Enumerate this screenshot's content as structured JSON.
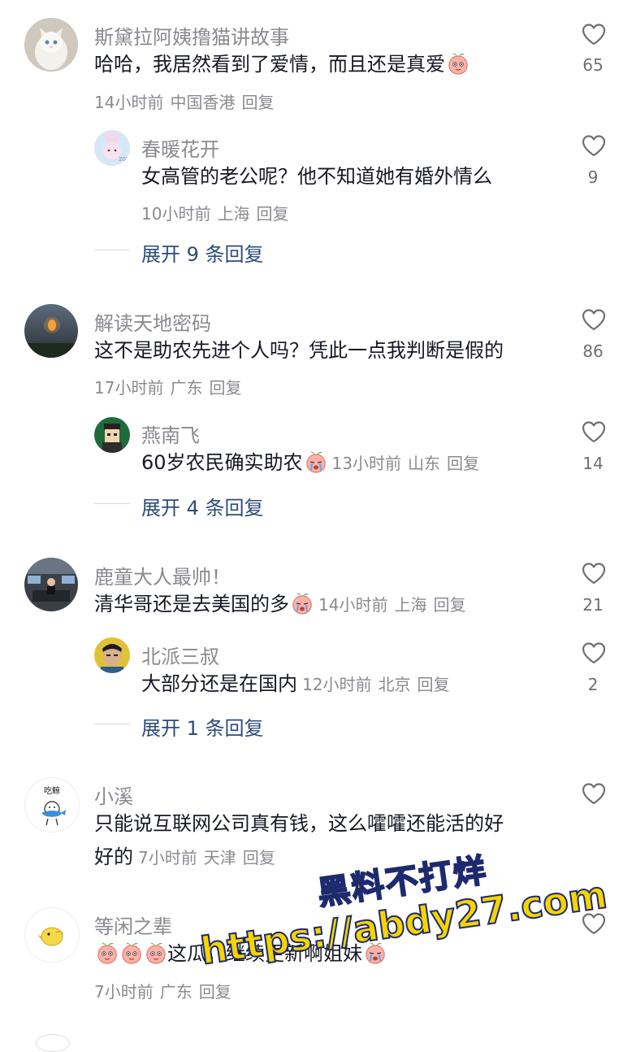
{
  "comments": [
    {
      "username": "斯黛拉阿姨撸猫讲故事",
      "text": "哈哈，我居然看到了爱情，而且还是真爱",
      "time": "14小时前",
      "location": "中国香港",
      "reply": "回复",
      "likes": "65",
      "emoji": "peach-face-icon",
      "replies": [
        {
          "username": "春暖花开",
          "text": "女高管的老公呢？他不知道她有婚外情么",
          "time": "10小时前",
          "location": "上海",
          "reply": "回复",
          "likes": "9"
        }
      ],
      "expand": "展开 9 条回复"
    },
    {
      "username": "解读天地密码",
      "text": "这不是助农先进个人吗？凭此一点我判断是假的",
      "time": "17小时前",
      "location": "广东",
      "reply": "回复",
      "likes": "86",
      "replies": [
        {
          "username": "燕南飞",
          "text": "60岁农民确实助农",
          "time": "13小时前",
          "location": "山东",
          "reply": "回复",
          "likes": "14",
          "emoji": "crying-peach-icon"
        }
      ],
      "expand": "展开 4 条回复"
    },
    {
      "username": "鹿童大人最帅！",
      "text": "清华哥还是去美国的多",
      "time": "14小时前",
      "location": "上海",
      "reply": "回复",
      "likes": "21",
      "emoji": "crying-peach-icon",
      "replies": [
        {
          "username": "北派三叔",
          "text": "大部分还是在国内",
          "time": "12小时前",
          "location": "北京",
          "reply": "回复",
          "likes": "2"
        }
      ],
      "expand": "展开 1 条回复"
    },
    {
      "username": "小溪",
      "avatar_text": "吃鲸",
      "text_line1": "只能说互联网公司真有钱，这么嚯嚯还能活的好",
      "text_line2": "好的",
      "time": "7小时前",
      "location": "天津",
      "reply": "回复"
    },
    {
      "username": "等闲之辈",
      "text": "这瓜，继续更新啊姐妹",
      "time": "7小时前",
      "location": "广东",
      "reply": "回复"
    }
  ],
  "watermark": {
    "line1": "黑料不打烊",
    "line2": "https://abdy27.com"
  },
  "colors": {
    "username": "#8a8a8f",
    "text": "#161823",
    "expand": "#2c4c78",
    "watermark": "#f5d400"
  }
}
